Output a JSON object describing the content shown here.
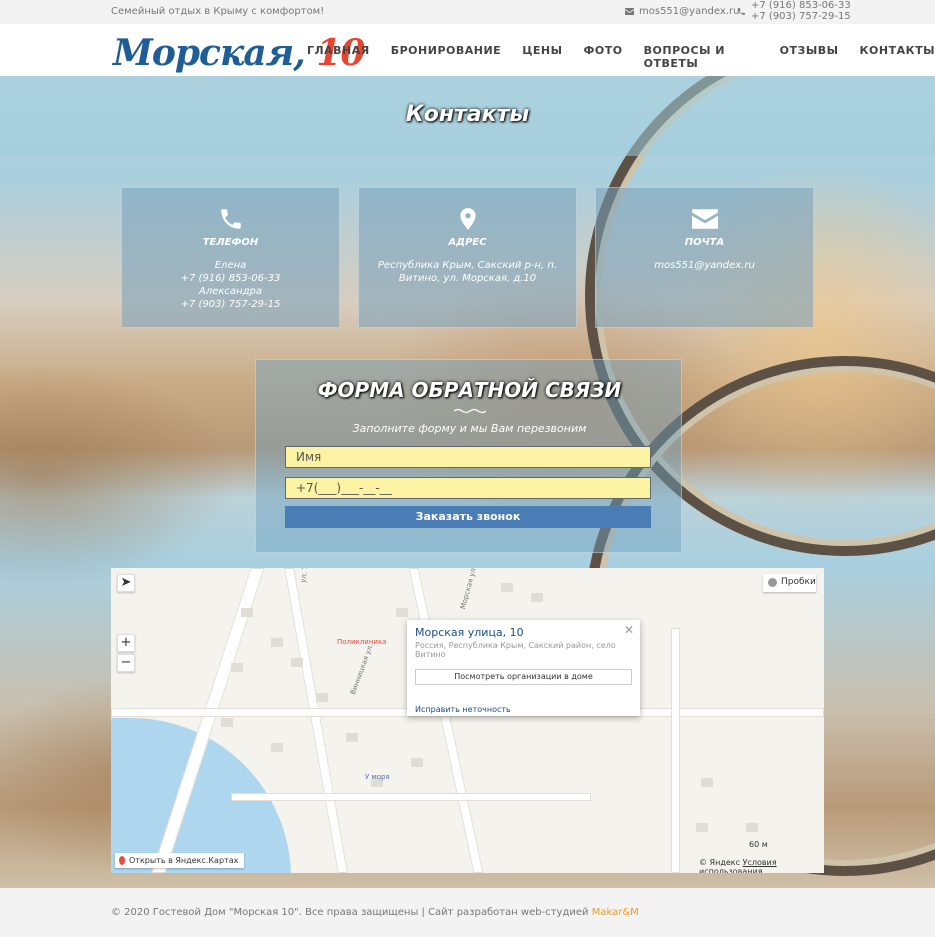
{
  "topbar": {
    "tagline": "Семейный отдых в Крыму с комфортом!",
    "email": "mos551@yandex.ru",
    "phone1": "+7 (916) 853-06-33",
    "phone2": "+7 (903) 757-29-15"
  },
  "logo": {
    "name": "Морская,",
    "number": "10"
  },
  "nav": [
    "ГЛАВНАЯ",
    "БРОНИРОВАНИЕ",
    "ЦЕНЫ",
    "ФОТО",
    "ВОПРОСЫ И ОТВЕТЫ",
    "ОТЗЫВЫ",
    "КОНТАКТЫ"
  ],
  "hero": {
    "title": "Контакты"
  },
  "cards": [
    {
      "icon": "phone-icon",
      "title": "ТЕЛЕФОН",
      "lines": [
        "Елена",
        "+7 (916) 853-06-33",
        "Александра",
        "+7 (903) 757-29-15"
      ]
    },
    {
      "icon": "map-marker-icon",
      "title": "АДРЕС",
      "lines": [
        "Республика Крым, Сакский р-н, п.",
        "Витино, ул. Морская, д.10"
      ]
    },
    {
      "icon": "envelope-icon",
      "title": "ПОЧТА",
      "lines": [
        "mos551@yandex.ru"
      ]
    }
  ],
  "form": {
    "title": "ФОРМА ОБРАТНОЙ СВЯЗИ",
    "subtitle": "Заполните форму и мы Вам перезвоним",
    "name_placeholder": "Имя",
    "phone_value": "+7(___)___-__-__",
    "submit": "Заказать звонок"
  },
  "map": {
    "traffic": "Пробки",
    "balloon_title": "Морская улица, 10",
    "balloon_address": "Россия, Республика Крым, Сакский район, село Витино",
    "balloon_button": "Посмотреть организации в доме",
    "balloon_link": "Исправить неточность",
    "open_in": "Открыть в Яндекс.Картах",
    "copyright": "© Яндекс",
    "terms": "Условия использования",
    "scale": "60 м",
    "clinic": "Поликлиника",
    "place": "У моря",
    "street1": "Морская ул.",
    "street2": "Винницкая ул.",
    "street3": "ул. Т"
  },
  "footer": {
    "text": "© 2020 Гостевой Дом \"Морская 10\". Все права защищены | Сайт разработан web-студией",
    "brand": "Makar&M"
  }
}
